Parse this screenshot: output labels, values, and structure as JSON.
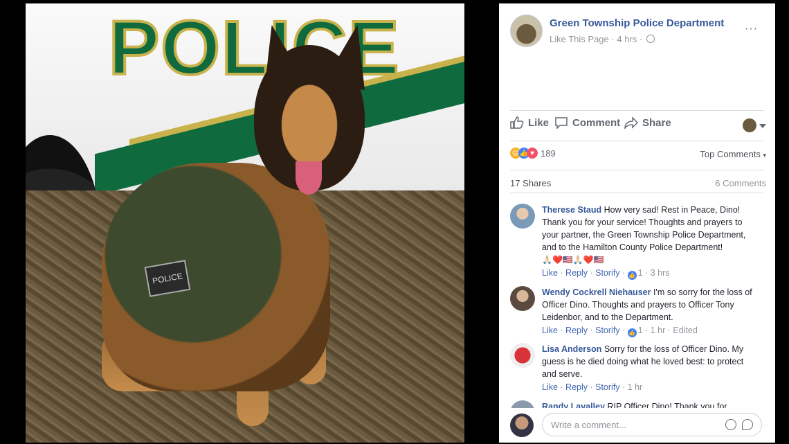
{
  "post": {
    "page_name": "Green Township Police Department",
    "like_page": "Like This Page",
    "time": "4 hrs",
    "separator": "·",
    "more": "···"
  },
  "actions": {
    "like": "Like",
    "comment": "Comment",
    "share": "Share"
  },
  "reactions": {
    "count": "189",
    "top_comments": "Top Comments"
  },
  "stats": {
    "shares": "17 Shares",
    "comments": "6 Comments"
  },
  "comments": [
    {
      "name": "Therese Staud",
      "text": "How very sad! Rest in Peace, Dino! Thank you for your service! Thoughts and prayers to your partner, the Green Township Police Department, and to the Hamilton County Police Department!",
      "emoji": "🙏🏻❤️🇺🇸🙏🏻❤️🇺🇸",
      "like": "Like",
      "reply": "Reply",
      "storify": "Storify",
      "likes": "1",
      "time": "3 hrs",
      "edited": ""
    },
    {
      "name": "Wendy Cockrell Niehauser",
      "text": "I'm so sorry for the loss of Officer Dino. Thoughts and prayers to Officer Tony Leidenbor, and to the Department.",
      "emoji": "",
      "like": "Like",
      "reply": "Reply",
      "storify": "Storify",
      "likes": "1",
      "time": "1 hr",
      "edited": "Edited"
    },
    {
      "name": "Lisa Anderson",
      "text": "Sorry for the loss of Officer Dino. My guess is he died doing what he loved best: to protect and serve.",
      "emoji": "",
      "like": "Like",
      "reply": "Reply",
      "storify": "Storify",
      "likes": "",
      "time": "1 hr",
      "edited": ""
    },
    {
      "name": "Randy Lavalley",
      "text": "RIP Officer Dino! Thank you for",
      "emoji": "",
      "like": "",
      "reply": "",
      "storify": "",
      "likes": "",
      "time": "",
      "edited": ""
    }
  ],
  "composer": {
    "placeholder": "Write a comment..."
  },
  "photo": {
    "car_text": "POLICE",
    "vest_patch": "POLICE"
  },
  "colors": {
    "fb_blue": "#365899",
    "link_blue": "#4267b2",
    "muted": "#90949c",
    "police_green": "#0f6b3e",
    "police_gold": "#c8b24b"
  },
  "icons": [
    "thumbs-up-icon",
    "comment-icon",
    "share-icon",
    "globe-icon",
    "more-icon",
    "sad-react-icon",
    "like-react-icon",
    "love-react-icon",
    "emoji-icon",
    "sticker-icon",
    "caret-down-icon"
  ]
}
